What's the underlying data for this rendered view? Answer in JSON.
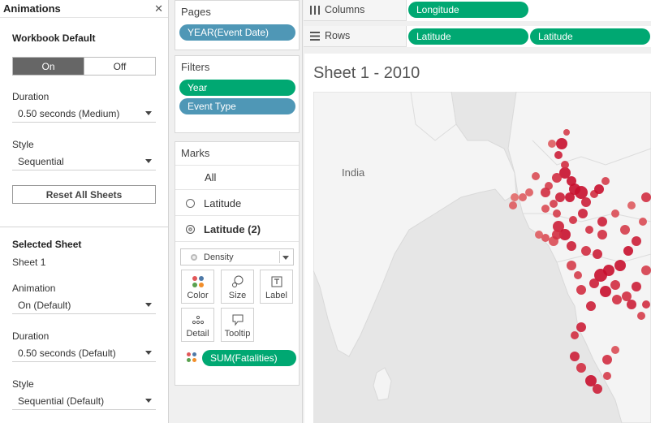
{
  "animations": {
    "title": "Animations",
    "close_icon": "close-icon",
    "workbook_default": {
      "heading": "Workbook Default",
      "toggle_on": "On",
      "toggle_off": "Off",
      "toggle_selected": "On",
      "duration_label": "Duration",
      "duration_value": "0.50 seconds (Medium)",
      "style_label": "Style",
      "style_value": "Sequential",
      "reset_label": "Reset All Sheets"
    },
    "selected_sheet": {
      "heading": "Selected Sheet",
      "sheet_name": "Sheet 1",
      "animation_label": "Animation",
      "animation_value": "On (Default)",
      "duration_label": "Duration",
      "duration_value": "0.50 seconds (Default)",
      "style_label": "Style",
      "style_value": "Sequential (Default)"
    }
  },
  "pages": {
    "title": "Pages",
    "pill": "YEAR(Event Date)"
  },
  "filters": {
    "title": "Filters",
    "pills": [
      "Year",
      "Event Type"
    ]
  },
  "marks": {
    "title": "Marks",
    "all_label": "All",
    "layers": [
      {
        "label": "Latitude",
        "selected": false
      },
      {
        "label": "Latitude (2)",
        "selected": true
      }
    ],
    "mark_type": "Density",
    "buttons": {
      "color": "Color",
      "size": "Size",
      "label": "Label",
      "detail": "Detail",
      "tooltip": "Tooltip"
    },
    "color_pill": "SUM(Fatalities)"
  },
  "shelves": {
    "columns_label": "Columns",
    "columns_pills": [
      "Longitude"
    ],
    "rows_label": "Rows",
    "rows_pills": [
      "Latitude",
      "Latitude"
    ]
  },
  "sheet": {
    "title": "Sheet 1 - 2010",
    "map_label": "India",
    "colors": {
      "accent_green": "#00a872",
      "pill_blue": "#4f97b6",
      "mark_dark": "#c8102e",
      "mark_light": "#f4a58f"
    }
  }
}
